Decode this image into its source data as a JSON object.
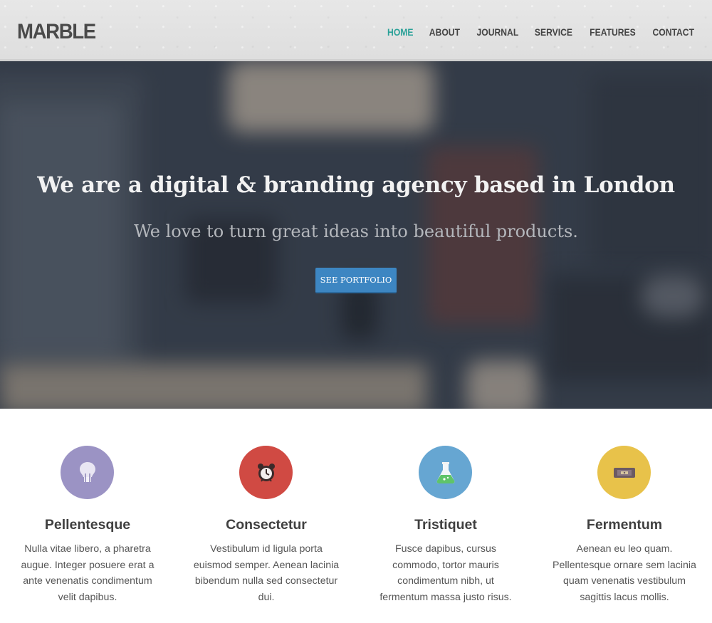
{
  "header": {
    "logo": "MARBLE",
    "nav": [
      "HOME",
      "ABOUT",
      "JOURNAL",
      "SERVICE",
      "FEATURES",
      "CONTACT"
    ],
    "active_nav": "HOME",
    "accent_color": "#2aa198"
  },
  "hero": {
    "title": "We are a digital & branding agency based in London",
    "subtitle": "We love to turn great ideas into beautiful products.",
    "button_label": "SEE PORTFOLIO",
    "button_color": "#3d86c2"
  },
  "features": [
    {
      "icon": "lightbulb-icon",
      "color": "#9b93c4",
      "title": "Pellentesque",
      "lines": [
        "Nulla vitae libero, a pharetra",
        "augue. Integer posuere erat a",
        "ante venenatis condimentum",
        "velit dapibus."
      ]
    },
    {
      "icon": "alarm-clock-icon",
      "color": "#d04a43",
      "title": "Consectetur",
      "lines": [
        "Vestibulum id ligula porta",
        "euismod semper. Aenean lacinia",
        "bibendum nulla sed consectetur",
        "dui."
      ]
    },
    {
      "icon": "flask-icon",
      "color": "#66a6d2",
      "title": "Tristiquet",
      "lines": [
        "Fusce dapibus, cursus",
        "commodo, tortor mauris",
        "condimentum nibh, ut",
        "fermentum massa justo risus."
      ]
    },
    {
      "icon": "ticket-icon",
      "color": "#e8c24a",
      "title": "Fermentum",
      "lines": [
        "Aenean eu leo quam.",
        "Pellentesque ornare sem lacinia",
        "quam venenatis vestibulum",
        "sagittis lacus mollis."
      ]
    }
  ]
}
